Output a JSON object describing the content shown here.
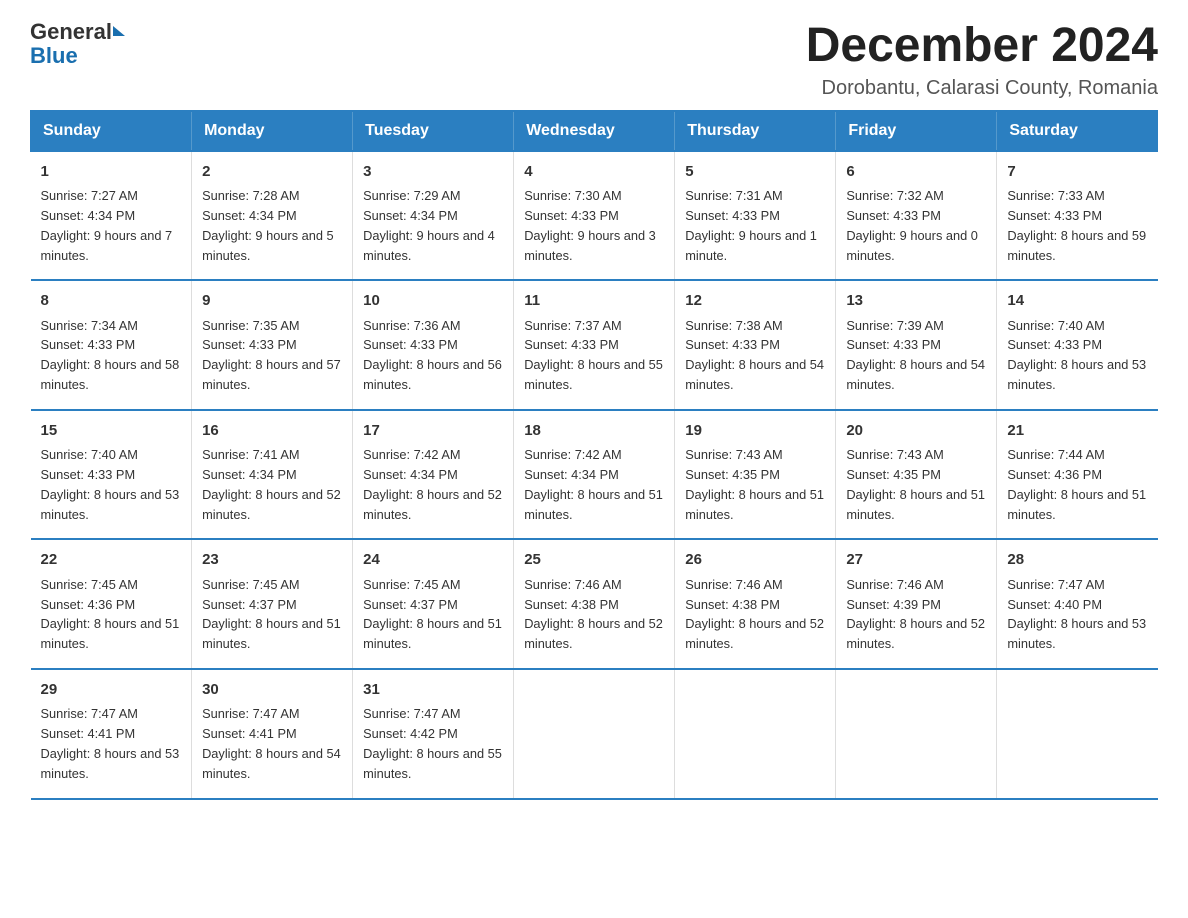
{
  "header": {
    "logo_text_general": "General",
    "logo_text_blue": "Blue",
    "title": "December 2024",
    "subtitle": "Dorobantu, Calarasi County, Romania"
  },
  "weekdays": [
    "Sunday",
    "Monday",
    "Tuesday",
    "Wednesday",
    "Thursday",
    "Friday",
    "Saturday"
  ],
  "weeks": [
    [
      {
        "day": "1",
        "sunrise": "7:27 AM",
        "sunset": "4:34 PM",
        "daylight": "9 hours and 7 minutes."
      },
      {
        "day": "2",
        "sunrise": "7:28 AM",
        "sunset": "4:34 PM",
        "daylight": "9 hours and 5 minutes."
      },
      {
        "day": "3",
        "sunrise": "7:29 AM",
        "sunset": "4:34 PM",
        "daylight": "9 hours and 4 minutes."
      },
      {
        "day": "4",
        "sunrise": "7:30 AM",
        "sunset": "4:33 PM",
        "daylight": "9 hours and 3 minutes."
      },
      {
        "day": "5",
        "sunrise": "7:31 AM",
        "sunset": "4:33 PM",
        "daylight": "9 hours and 1 minute."
      },
      {
        "day": "6",
        "sunrise": "7:32 AM",
        "sunset": "4:33 PM",
        "daylight": "9 hours and 0 minutes."
      },
      {
        "day": "7",
        "sunrise": "7:33 AM",
        "sunset": "4:33 PM",
        "daylight": "8 hours and 59 minutes."
      }
    ],
    [
      {
        "day": "8",
        "sunrise": "7:34 AM",
        "sunset": "4:33 PM",
        "daylight": "8 hours and 58 minutes."
      },
      {
        "day": "9",
        "sunrise": "7:35 AM",
        "sunset": "4:33 PM",
        "daylight": "8 hours and 57 minutes."
      },
      {
        "day": "10",
        "sunrise": "7:36 AM",
        "sunset": "4:33 PM",
        "daylight": "8 hours and 56 minutes."
      },
      {
        "day": "11",
        "sunrise": "7:37 AM",
        "sunset": "4:33 PM",
        "daylight": "8 hours and 55 minutes."
      },
      {
        "day": "12",
        "sunrise": "7:38 AM",
        "sunset": "4:33 PM",
        "daylight": "8 hours and 54 minutes."
      },
      {
        "day": "13",
        "sunrise": "7:39 AM",
        "sunset": "4:33 PM",
        "daylight": "8 hours and 54 minutes."
      },
      {
        "day": "14",
        "sunrise": "7:40 AM",
        "sunset": "4:33 PM",
        "daylight": "8 hours and 53 minutes."
      }
    ],
    [
      {
        "day": "15",
        "sunrise": "7:40 AM",
        "sunset": "4:33 PM",
        "daylight": "8 hours and 53 minutes."
      },
      {
        "day": "16",
        "sunrise": "7:41 AM",
        "sunset": "4:34 PM",
        "daylight": "8 hours and 52 minutes."
      },
      {
        "day": "17",
        "sunrise": "7:42 AM",
        "sunset": "4:34 PM",
        "daylight": "8 hours and 52 minutes."
      },
      {
        "day": "18",
        "sunrise": "7:42 AM",
        "sunset": "4:34 PM",
        "daylight": "8 hours and 51 minutes."
      },
      {
        "day": "19",
        "sunrise": "7:43 AM",
        "sunset": "4:35 PM",
        "daylight": "8 hours and 51 minutes."
      },
      {
        "day": "20",
        "sunrise": "7:43 AM",
        "sunset": "4:35 PM",
        "daylight": "8 hours and 51 minutes."
      },
      {
        "day": "21",
        "sunrise": "7:44 AM",
        "sunset": "4:36 PM",
        "daylight": "8 hours and 51 minutes."
      }
    ],
    [
      {
        "day": "22",
        "sunrise": "7:45 AM",
        "sunset": "4:36 PM",
        "daylight": "8 hours and 51 minutes."
      },
      {
        "day": "23",
        "sunrise": "7:45 AM",
        "sunset": "4:37 PM",
        "daylight": "8 hours and 51 minutes."
      },
      {
        "day": "24",
        "sunrise": "7:45 AM",
        "sunset": "4:37 PM",
        "daylight": "8 hours and 51 minutes."
      },
      {
        "day": "25",
        "sunrise": "7:46 AM",
        "sunset": "4:38 PM",
        "daylight": "8 hours and 52 minutes."
      },
      {
        "day": "26",
        "sunrise": "7:46 AM",
        "sunset": "4:38 PM",
        "daylight": "8 hours and 52 minutes."
      },
      {
        "day": "27",
        "sunrise": "7:46 AM",
        "sunset": "4:39 PM",
        "daylight": "8 hours and 52 minutes."
      },
      {
        "day": "28",
        "sunrise": "7:47 AM",
        "sunset": "4:40 PM",
        "daylight": "8 hours and 53 minutes."
      }
    ],
    [
      {
        "day": "29",
        "sunrise": "7:47 AM",
        "sunset": "4:41 PM",
        "daylight": "8 hours and 53 minutes."
      },
      {
        "day": "30",
        "sunrise": "7:47 AM",
        "sunset": "4:41 PM",
        "daylight": "8 hours and 54 minutes."
      },
      {
        "day": "31",
        "sunrise": "7:47 AM",
        "sunset": "4:42 PM",
        "daylight": "8 hours and 55 minutes."
      },
      null,
      null,
      null,
      null
    ]
  ],
  "labels": {
    "sunrise": "Sunrise:",
    "sunset": "Sunset:",
    "daylight": "Daylight:"
  }
}
